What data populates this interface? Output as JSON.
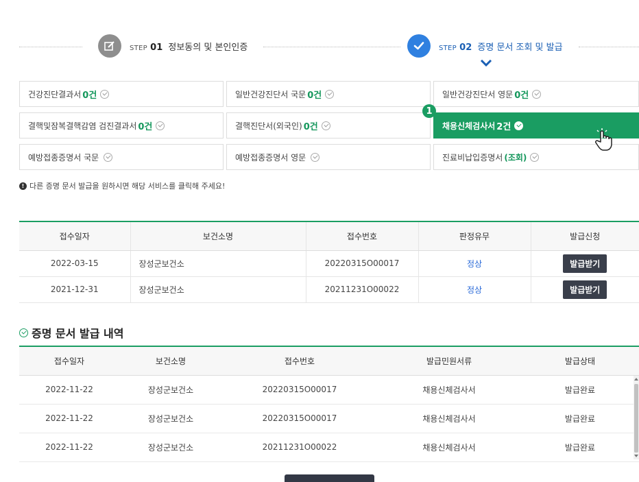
{
  "steps": {
    "step1": {
      "prefix": "STEP",
      "num": "01",
      "label": "정보동의 및 본인인증"
    },
    "step2": {
      "prefix": "STEP",
      "num": "02",
      "label": "증명 문서 조회 및 발급"
    }
  },
  "docs": [
    {
      "label": "건강진단결과서",
      "count": "0건"
    },
    {
      "label": "일반건강진단서 국문",
      "count": "0건"
    },
    {
      "label": "일반건강진단서 영문",
      "count": "0건"
    },
    {
      "label": "결핵및잠복결핵감염 검진결과서",
      "count": "0건"
    },
    {
      "label": "결핵진단서(외국인)",
      "count": "0건"
    },
    {
      "label": "채용신체검사서",
      "count": "2건"
    },
    {
      "label": "예방접종증명서 국문",
      "count": ""
    },
    {
      "label": "예방접종증명서 영문",
      "count": ""
    },
    {
      "label": "진료비납입증명서",
      "count": "(조회)"
    }
  ],
  "badge": "1",
  "notice": "다른 증명 문서 발급을 원하시면 해당 서비스를 클릭해 주세요!",
  "results": {
    "headers": [
      "접수일자",
      "보건소명",
      "접수번호",
      "판정유무",
      "발급신청"
    ],
    "rows": [
      {
        "date": "2022-03-15",
        "center": "장성군보건소",
        "no": "20220315O00017",
        "result": "정상",
        "action": "발급받기"
      },
      {
        "date": "2021-12-31",
        "center": "장성군보건소",
        "no": "20211231O00022",
        "result": "정상",
        "action": "발급받기"
      }
    ]
  },
  "history": {
    "title": "증명 문서 발급 내역",
    "headers": [
      "접수일자",
      "보건소명",
      "접수번호",
      "발급민원서류",
      "발급상태"
    ],
    "rows": [
      {
        "date": "2022-11-22",
        "center": "장성군보건소",
        "no": "20220315O00017",
        "doc": "채용신체검사서",
        "status": "발급완료"
      },
      {
        "date": "2022-11-22",
        "center": "장성군보건소",
        "no": "20220315O00017",
        "doc": "채용신체검사서",
        "status": "발급완료"
      },
      {
        "date": "2022-11-22",
        "center": "장성군보건소",
        "no": "20211231O00022",
        "doc": "채용신체검사서",
        "status": "발급완료"
      }
    ]
  },
  "colors": {
    "accent": "#1a9d62",
    "step_active": "#2f80e0",
    "button": "#3a3f4b"
  }
}
